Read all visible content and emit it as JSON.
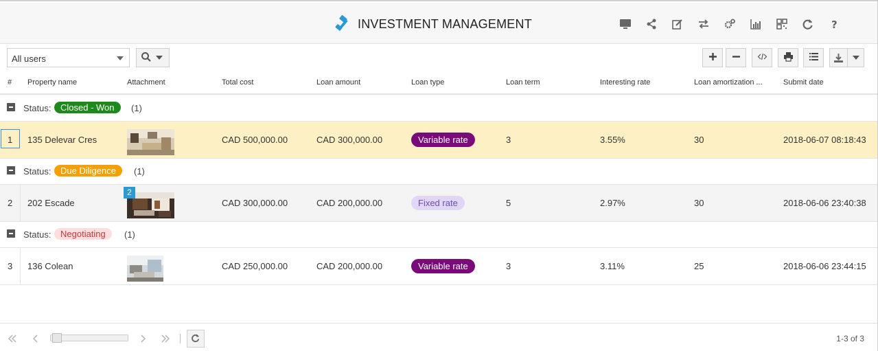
{
  "header": {
    "title": "INVESTMENT MANAGEMENT",
    "title_icon": "gavel-icon",
    "icons": [
      "monitor-icon",
      "share-icon",
      "edit-icon",
      "transfer-icon",
      "settings-icon",
      "chart-icon",
      "qrcode-icon",
      "refresh-icon",
      "help-icon"
    ]
  },
  "toolbar": {
    "user_filter": "All users",
    "buttons": [
      "add-icon",
      "remove-icon",
      "code-icon",
      "print-icon",
      "list-icon",
      "download-icon"
    ]
  },
  "columns": [
    "#",
    "Property name",
    "Attachment",
    "Total cost",
    "Loan amount",
    "Loan type",
    "Loan term",
    "Interesting rate",
    "Loan amortization ...",
    "Submit date"
  ],
  "groups": [
    {
      "label": "Status:",
      "status": "Closed - Won",
      "status_color": "#1e8a1e",
      "count": "(1)",
      "rows": [
        {
          "index": "1",
          "name": "135 Delevar Cres",
          "attach_count": "",
          "total": "CAD 500,000.00",
          "loan": "CAD 300,000.00",
          "type": "Variable rate",
          "term": "3",
          "rate": "3.55%",
          "amort": "30",
          "date": "2018-06-07 08:18:43"
        }
      ]
    },
    {
      "label": "Status:",
      "status": "Due Diligence",
      "status_color": "#f5a000",
      "count": "(1)",
      "rows": [
        {
          "index": "2",
          "name": "202 Escade",
          "attach_count": "2",
          "total": "CAD 300,000.00",
          "loan": "CAD 200,000.00",
          "type": "Fixed rate",
          "term": "5",
          "rate": "2.97%",
          "amort": "30",
          "date": "2018-06-06 23:40:38"
        }
      ]
    },
    {
      "label": "Status:",
      "status": "Negotiating",
      "status_color": "#fcdede",
      "count": "(1)",
      "rows": [
        {
          "index": "3",
          "name": "136 Colean",
          "attach_count": "",
          "total": "CAD 250,000.00",
          "loan": "CAD 200,000.00",
          "type": "Variable rate",
          "term": "3",
          "rate": "3.11%",
          "amort": "25",
          "date": "2018-06-06 23:44:15"
        }
      ]
    }
  ],
  "footer": {
    "page_info": "1-3 of 3"
  },
  "colors": {
    "selected_row": "#fdf0c4",
    "variable_rate": "#7a0a7a",
    "fixed_rate": "#e2d6f7",
    "accent_blue": "#2a9ad6"
  }
}
